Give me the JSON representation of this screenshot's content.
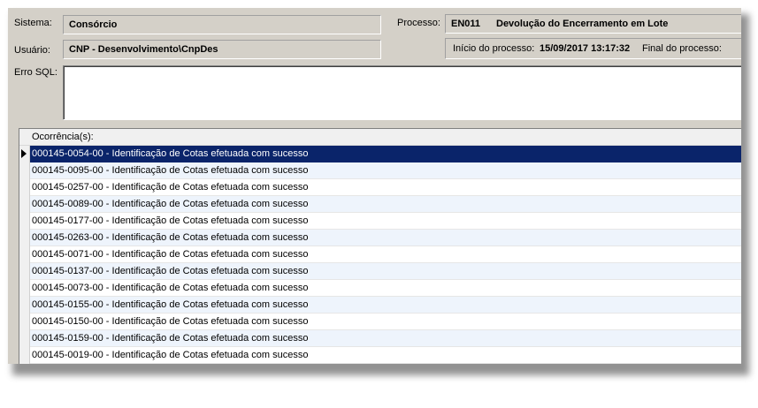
{
  "header": {
    "sistema_label": "Sistema:",
    "sistema_value": "Consórcio",
    "usuario_label": "Usuário:",
    "usuario_value": "CNP - Desenvolvimento\\CnpDes",
    "processo_label": "Processo:",
    "processo_code": "EN011",
    "processo_name": "Devolução do Encerramento em Lote",
    "inicio_label": "Início do processo:",
    "inicio_value": "15/09/2017 13:17:32",
    "final_label": "Final do processo:",
    "final_value": "",
    "erro_sql_label": "Erro SQL:",
    "erro_sql_value": ""
  },
  "grid": {
    "column_header": "Ocorrência(s):",
    "selected_index": 0,
    "rows": [
      "000145-0054-00 - Identificação de Cotas efetuada com sucesso",
      "000145-0095-00 - Identificação de Cotas efetuada com sucesso",
      "000145-0257-00 - Identificação de Cotas efetuada com sucesso",
      "000145-0089-00 - Identificação de Cotas efetuada com sucesso",
      "000145-0177-00 - Identificação de Cotas efetuada com sucesso",
      "000145-0263-00 - Identificação de Cotas efetuada com sucesso",
      "000145-0071-00 - Identificação de Cotas efetuada com sucesso",
      "000145-0137-00 - Identificação de Cotas efetuada com sucesso",
      "000145-0073-00 - Identificação de Cotas efetuada com sucesso",
      "000145-0155-00 - Identificação de Cotas efetuada com sucesso",
      "000145-0150-00 - Identificação de Cotas efetuada com sucesso",
      "000145-0159-00 - Identificação de Cotas efetuada com sucesso",
      "000145-0019-00 - Identificação de Cotas efetuada com sucesso"
    ]
  },
  "colors": {
    "window_bg": "#d4d0c8",
    "selection_bg": "#0a246a",
    "alt_row_bg": "#eef4fc"
  },
  "icons": {
    "row_indicator": "current-row-arrow-icon"
  }
}
